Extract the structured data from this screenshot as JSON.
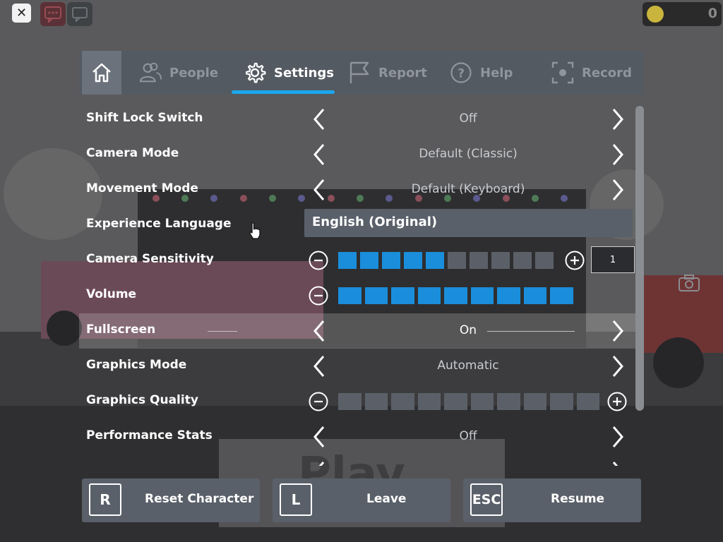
{
  "hud": {
    "close_icon": "close-icon",
    "chat_icon": "chat-icon",
    "coins_value": "0"
  },
  "tabs": [
    {
      "label": "",
      "icon": "home-icon"
    },
    {
      "label": "People",
      "icon": "people-icon"
    },
    {
      "label": "Settings",
      "icon": "gear-icon"
    },
    {
      "label": "Report",
      "icon": "flag-icon"
    },
    {
      "label": "Help",
      "icon": "question-icon"
    },
    {
      "label": "Record",
      "icon": "record-icon"
    }
  ],
  "active_tab": "Settings",
  "settings": [
    {
      "label": "Shift Lock Switch",
      "value": "Off"
    },
    {
      "label": "Camera Mode",
      "value": "Default (Classic)"
    },
    {
      "label": "Movement Mode",
      "value": "Default (Keyboard)"
    },
    {
      "label": "Experience Language",
      "value": "English (Original)"
    },
    {
      "label": "Camera Sensitivity",
      "level": 5,
      "max": 10,
      "input_value": "1"
    },
    {
      "label": "Volume",
      "level": 9,
      "max": 9
    },
    {
      "label": "Fullscreen",
      "value": "On"
    },
    {
      "label": "Graphics Mode",
      "value": "Automatic"
    },
    {
      "label": "Graphics Quality",
      "level": 0,
      "max": 10
    },
    {
      "label": "Performance Stats",
      "value": "Off"
    }
  ],
  "buttons": [
    {
      "key": "R",
      "label": "Reset Character"
    },
    {
      "key": "L",
      "label": "Leave"
    },
    {
      "key": "ESC",
      "label": "Resume"
    }
  ],
  "colors": {
    "accent": "#1aa8ec",
    "slider_on": "#1a8edb",
    "slider_off": "#5b6068",
    "panel": "#545a62"
  }
}
